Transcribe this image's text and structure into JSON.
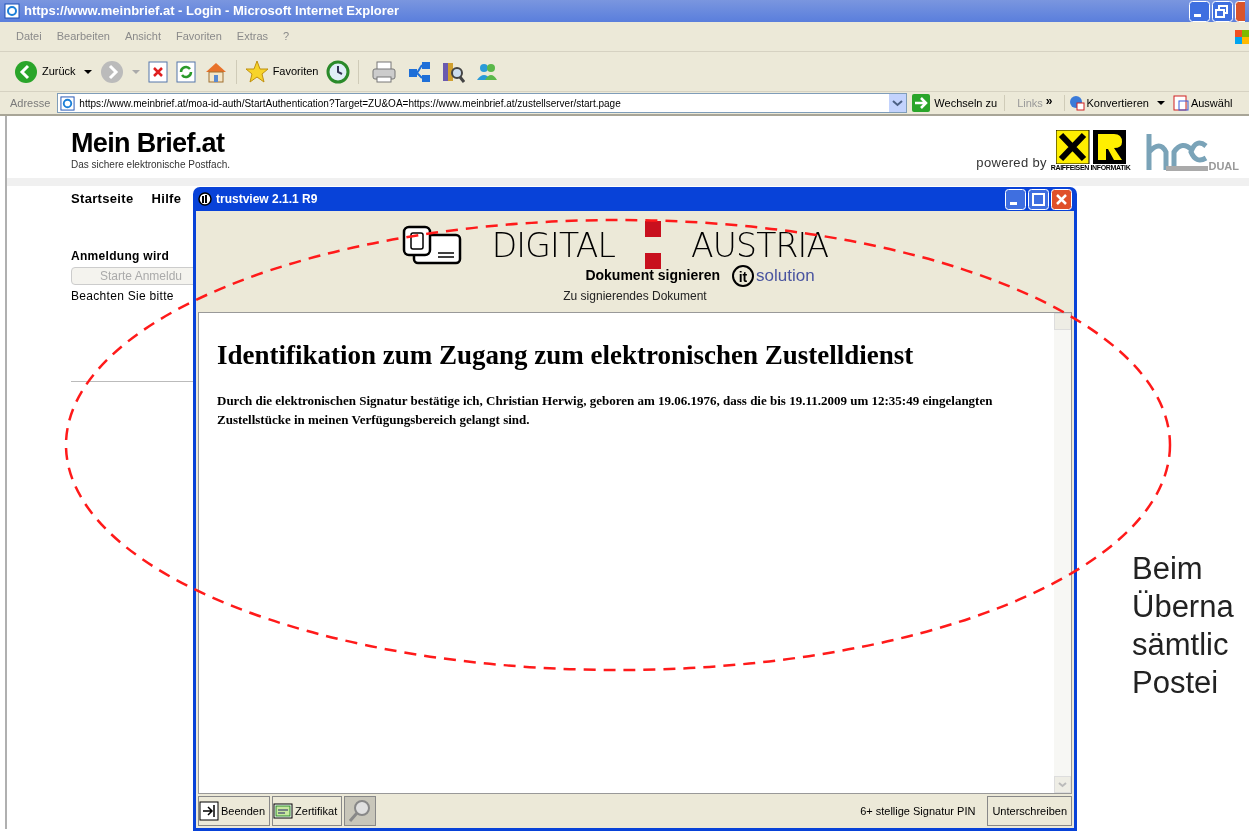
{
  "window": {
    "title": "https://www.meinbrief.at - Login - Microsoft Internet Explorer"
  },
  "menu": [
    "Datei",
    "Bearbeiten",
    "Ansicht",
    "Favoriten",
    "Extras",
    "?"
  ],
  "toolbar": {
    "back": "Zurück",
    "favorites": "Favoriten"
  },
  "address_bar": {
    "label": "Adresse",
    "url": "https://www.meinbrief.at/moa-id-auth/StartAuthentication?Target=ZU&OA=https://www.meinbrief.at/zustellserver/start.page",
    "go": "Wechseln zu",
    "links": "Links",
    "more": "»",
    "convert": "Konvertieren",
    "select": "Auswähl"
  },
  "page": {
    "logo": "Mein Brief.at",
    "tagline": "Das sichere elektronische Postfach.",
    "powered_by": "powered by",
    "partner_caption": "RAIFFEISEN INFORMATIK",
    "partner2": "DUAL",
    "nav": [
      "Startseite",
      "Hilfe"
    ],
    "heading": "Anmeldung wird",
    "button": "Starte Anmeldu",
    "note": "Beachten Sie bitte"
  },
  "dialog": {
    "title": "trustview 2.1.1 R9",
    "brand_left": "DIGITAL",
    "brand_right": "AUSTRIA",
    "action": "Dokument signieren",
    "vendor_mark": "it",
    "vendor": "solution",
    "subtitle": "Zu signierendes Dokument",
    "document": {
      "heading": "Identifikation zum Zugang zum elektronischen Zustelldienst",
      "text": "Durch die elektronischen Signatur bestätige ich, Christian Herwig, geboren am 19.06.1976, dass die bis 19.11.2009 um 12:35:49 eingelangten Zustellstücke in meinen Verfügungsbereich gelangt sind."
    },
    "footer": {
      "quit": "Beenden",
      "certificate": "Zertifikat",
      "pin_label": "6+ stellige Signatur PIN",
      "sign": "Unterschreiben"
    }
  },
  "annotation": [
    "Beim",
    "Überna",
    "sämtlic",
    "Postei"
  ]
}
